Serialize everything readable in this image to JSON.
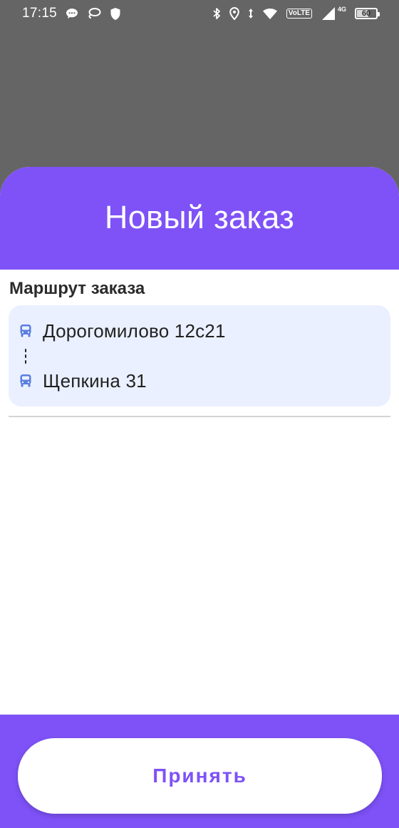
{
  "status_bar": {
    "time": "17:15",
    "left_icons": [
      "chat-bubble-icon",
      "lasso-icon",
      "shield-icon"
    ],
    "right_icons": [
      "bluetooth-icon",
      "location-icon",
      "data-arrows-icon",
      "wifi-icon",
      "volte-icon",
      "signal-icon",
      "battery-icon"
    ],
    "volte_label": "VoLTE",
    "network_label": "4G",
    "battery_level": "60"
  },
  "sheet": {
    "title": "Новый заказ",
    "header_color": "#7e52f7"
  },
  "route": {
    "heading": "Маршрут заказа",
    "stops": [
      {
        "icon": "bus-icon",
        "label": "Дорогомилово 12с21"
      },
      {
        "icon": "bus-icon",
        "label": "Щепкина 31"
      }
    ],
    "card_color": "#eaf0ff",
    "icon_color": "#5a7de0"
  },
  "footer": {
    "accept_label": "Принять",
    "accent_color": "#7e52f7"
  }
}
